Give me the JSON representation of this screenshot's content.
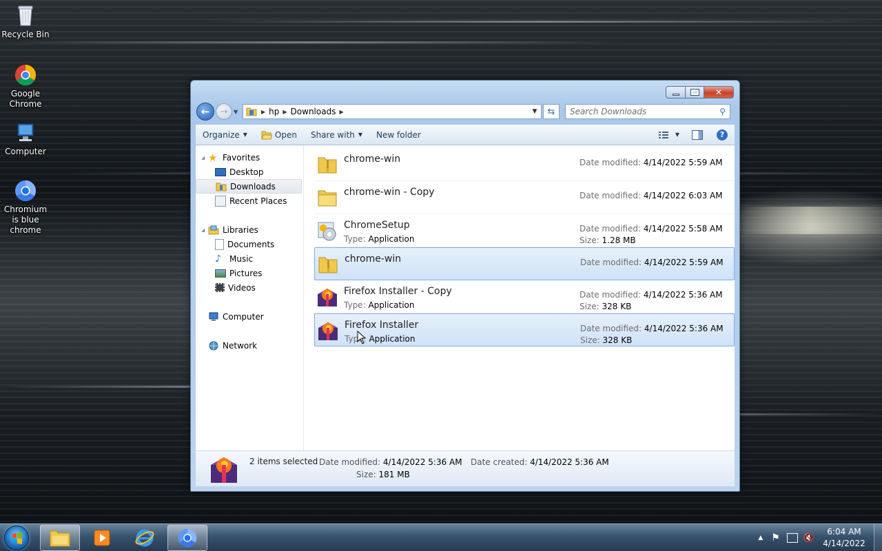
{
  "desktop": {
    "icons": [
      {
        "label": "Recycle Bin",
        "icon": "recycle-bin-icon"
      },
      {
        "label": "Google Chrome",
        "icon": "chrome-icon"
      },
      {
        "label": "Computer",
        "icon": "computer-icon"
      },
      {
        "label": "Chromium is blue chrome",
        "icon": "chromium-icon"
      }
    ]
  },
  "explorer": {
    "breadcrumb": [
      "hp",
      "Downloads"
    ],
    "search_placeholder": "Search Downloads",
    "toolbar": {
      "organize": "Organize",
      "open": "Open",
      "share_with": "Share with",
      "new_folder": "New folder"
    },
    "navpane": {
      "favorites": "Favorites",
      "desktop": "Desktop",
      "downloads": "Downloads",
      "recent_places": "Recent Places",
      "libraries": "Libraries",
      "documents": "Documents",
      "music": "Music",
      "pictures": "Pictures",
      "videos": "Videos",
      "computer": "Computer",
      "network": "Network"
    },
    "labels": {
      "date_modified": "Date modified:",
      "type": "Type:",
      "size": "Size:"
    },
    "files": [
      {
        "name": "chrome-win",
        "icon": "zip-folder-icon",
        "date": "4/14/2022 5:59 AM",
        "selected": false
      },
      {
        "name": "chrome-win - Copy",
        "icon": "folder-icon",
        "date": "4/14/2022 6:03 AM",
        "selected": false
      },
      {
        "name": "ChromeSetup",
        "icon": "setup-app-icon",
        "type": "Application",
        "date": "4/14/2022 5:58 AM",
        "size": "1.28 MB",
        "selected": false
      },
      {
        "name": "chrome-win",
        "icon": "zip-folder-icon",
        "date": "4/14/2022 5:59 AM",
        "selected": true
      },
      {
        "name": "Firefox Installer - Copy",
        "icon": "firefox-installer-icon",
        "type": "Application",
        "date": "4/14/2022 5:36 AM",
        "size": "328 KB",
        "selected": false
      },
      {
        "name": "Firefox Installer",
        "icon": "firefox-installer-icon",
        "type": "Application",
        "date": "4/14/2022 5:36 AM",
        "size": "328 KB",
        "selected": true
      }
    ],
    "details": {
      "selection": "2 items selected",
      "date_modified_label": "Date modified:",
      "date_modified": "4/14/2022 5:36 AM",
      "size_label": "Size:",
      "size": "181 MB",
      "date_created_label": "Date created:",
      "date_created": "4/14/2022 5:36 AM"
    }
  },
  "taskbar": {
    "apps": [
      "explorer-icon",
      "media-player-icon",
      "internet-explorer-icon",
      "chrome-icon"
    ],
    "clock": {
      "time": "6:04 AM",
      "date": "4/14/2022"
    }
  }
}
